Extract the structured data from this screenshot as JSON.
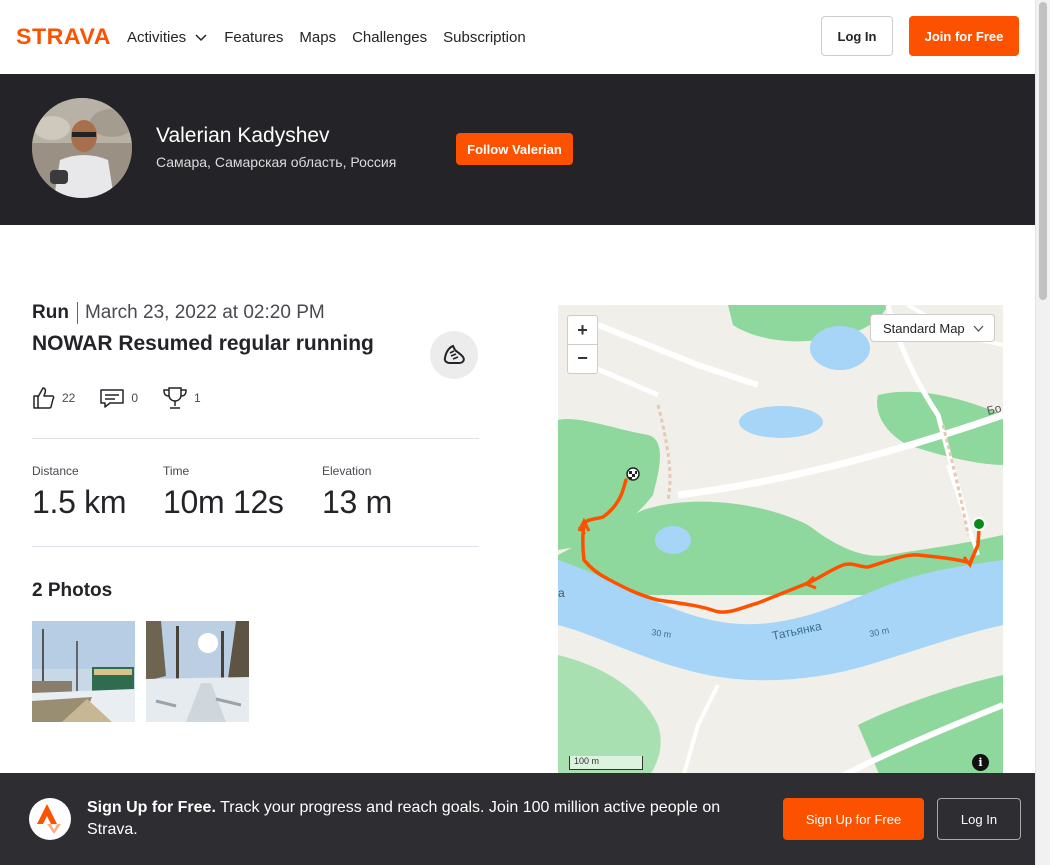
{
  "nav": {
    "logo_text": "STRAVA",
    "links": [
      "Activities",
      "Features",
      "Maps",
      "Challenges",
      "Subscription"
    ],
    "login_label": "Log In",
    "join_label": "Join for Free"
  },
  "athlete": {
    "name": "Valerian Kadyshev",
    "location": "Самара, Самарская область, Россия",
    "follow_label": "Follow Valerian"
  },
  "activity": {
    "type": "Run",
    "date": "March 23, 2022 at 02:20 PM",
    "title": "NOWAR Resumed regular running",
    "kudos": "22",
    "comments": "0",
    "achievements": "1",
    "stats": [
      {
        "label": "Distance",
        "value": "1.5 km"
      },
      {
        "label": "Time",
        "value": "10m 12s"
      },
      {
        "label": "Elevation",
        "value": "13 m"
      }
    ],
    "photos_title": "2 Photos"
  },
  "map": {
    "zoom_in": "+",
    "zoom_out": "−",
    "style_label": "Standard Map",
    "scale_label": "100 m",
    "info_label": "i",
    "labels": {
      "river": "Татьянка",
      "depth1": "30 m",
      "depth2": "30 m",
      "road": "Бо",
      "edge": "а"
    }
  },
  "signup": {
    "headline": "Sign Up for Free.",
    "body": "Track your progress and reach goals. Join 100 million active people on Strava.",
    "signup_label": "Sign Up for Free",
    "login_label": "Log In"
  },
  "colors": {
    "brand": "#fc5200",
    "dark": "#242428",
    "route": "#fc5200",
    "water": "#a6d5f7",
    "park": "#8cd59a"
  }
}
